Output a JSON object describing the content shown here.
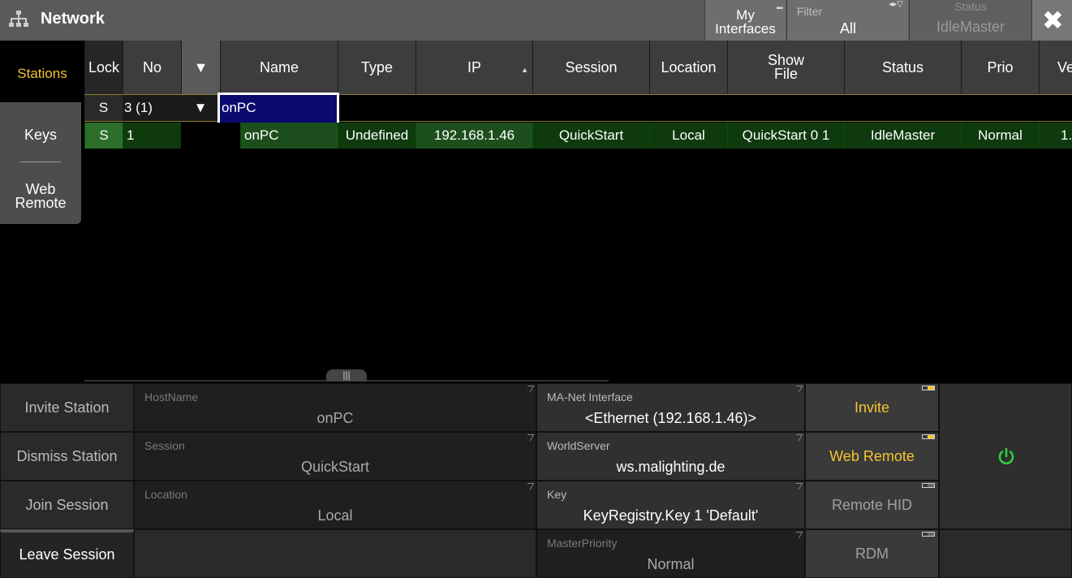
{
  "window": {
    "title": "Network",
    "my_interfaces_label": "My\nInterfaces",
    "filter": {
      "label": "Filter",
      "value": "All"
    },
    "status": {
      "label": "Status",
      "value": "IdleMaster"
    },
    "close_icon": "close-icon"
  },
  "tabs": {
    "stations": "Stations",
    "keys": "Keys",
    "web_remote": "Web Remote"
  },
  "columns": [
    "Lock",
    "No",
    "▼",
    "Name",
    "Type",
    "IP",
    "Session",
    "Location",
    "Show File",
    "Status",
    "Prio",
    "Ve"
  ],
  "filter_row": {
    "lock": "S",
    "no": "3 (1)",
    "arrow": "▼",
    "name": "onPC"
  },
  "rows": [
    {
      "lock": "S",
      "no": "1",
      "name": "onPC",
      "type": "Undefined",
      "ip": "192.168.1.46",
      "session": "QuickStart",
      "location": "Local",
      "show_file": "QuickStart 0 1",
      "status": "IdleMaster",
      "prio": "Normal",
      "ve": "1."
    }
  ],
  "actions": {
    "invite_station": "Invite Station",
    "dismiss_station": "Dismiss Station",
    "join_session": "Join Session",
    "leave_session": "Leave Session"
  },
  "fields": {
    "hostname": {
      "label": "HostName",
      "value": "onPC"
    },
    "session": {
      "label": "Session",
      "value": "QuickStart"
    },
    "location": {
      "label": "Location",
      "value": "Local"
    },
    "ma_net_interface": {
      "label": "MA-Net Interface",
      "value": "<Ethernet (192.168.1.46)>"
    },
    "world_server": {
      "label": "WorldServer",
      "value": "ws.malighting.de"
    },
    "key": {
      "label": "Key",
      "value": "KeyRegistry.Key 1 'Default'"
    },
    "master_priority": {
      "label": "MasterPriority",
      "value": "Normal"
    }
  },
  "toggles": {
    "invite": {
      "label": "Invite",
      "on": true
    },
    "web_remote": {
      "label": "Web Remote",
      "on": true
    },
    "remote_hid": {
      "label": "Remote HID",
      "on": false
    },
    "rdm": {
      "label": "RDM",
      "on": false
    }
  },
  "colors": {
    "accent": "#f4c430",
    "power": "#2ecc40",
    "selection": "#0a0a6e",
    "row_green": "#0e3a0e"
  }
}
